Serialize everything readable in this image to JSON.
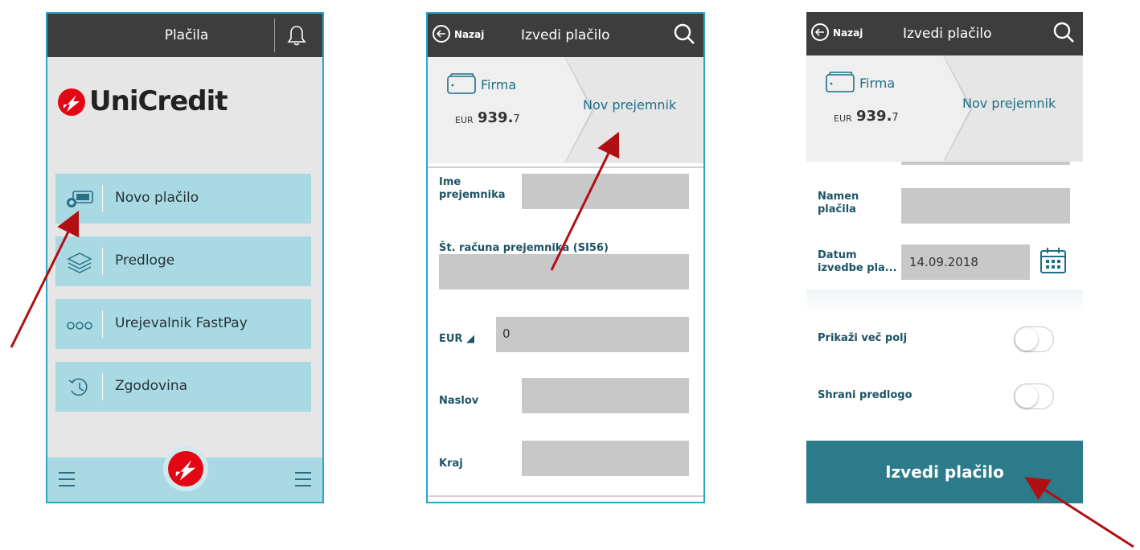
{
  "screen1": {
    "title": "Plačila",
    "logo_text": "UniCredit",
    "menu": [
      {
        "label": "Novo plačilo",
        "icon": "money-card-icon"
      },
      {
        "label": "Predloge",
        "icon": "layers-icon"
      },
      {
        "label": "Urejevalnik FastPay",
        "icon": "dots-icon"
      },
      {
        "label": "Zgodovina",
        "icon": "history-icon"
      }
    ]
  },
  "screen2": {
    "back_label": "Nazaj",
    "title": "Izvedi plačilo",
    "account": {
      "name": "Firma",
      "currency": "EUR",
      "amount_main": "939.",
      "amount_decimal": "7"
    },
    "recipient_label": "Nov prejemnik",
    "fields": {
      "name_label_1": "Ime",
      "name_label_2": "prejemnika",
      "iban_label": "Št. računa prejemnika (SI56)",
      "currency_label": "EUR ◢",
      "amount_value": "0",
      "address_label": "Naslov",
      "city_label": "Kraj"
    }
  },
  "screen3": {
    "back_label": "Nazaj",
    "title": "Izvedi plačilo",
    "account": {
      "name": "Firma",
      "currency": "EUR",
      "amount_main": "939.",
      "amount_decimal": "7"
    },
    "recipient_label": "Nov prejemnik",
    "purpose_label_1": "Namen",
    "purpose_label_2": "plačila",
    "date_label_1": "Datum",
    "date_label_2": "izvedbe pla...",
    "date_value": "14.09.2018",
    "show_more_label": "Prikaži več polj",
    "save_template_label": "Shrani predlogo",
    "cta_label": "Izvedi plačilo"
  },
  "colors": {
    "header": "#3d3d3d",
    "menu_item": "#a9dae3",
    "accent": "#1d6f88",
    "cta": "#2b7b8b",
    "brand_red": "#e30613",
    "arrow": "#b00f13"
  }
}
